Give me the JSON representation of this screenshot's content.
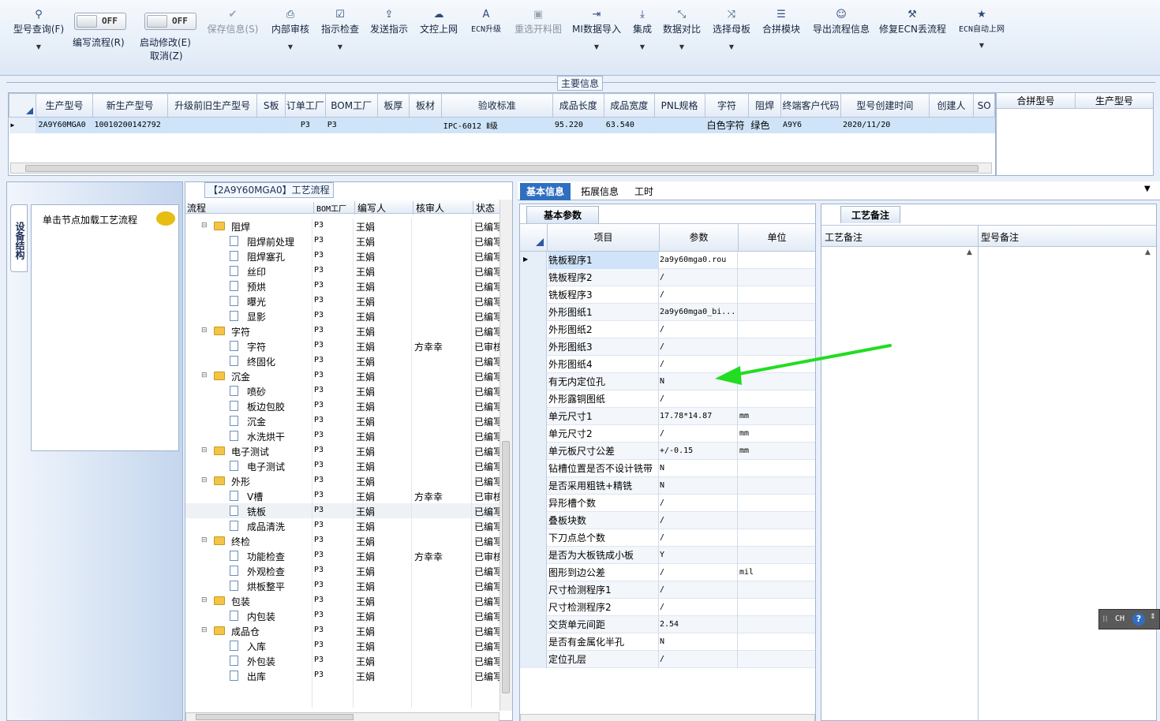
{
  "toolbar": {
    "query": "型号查询(F)",
    "edit_flow": "编写流程(R)",
    "toggle_off": "OFF",
    "start_modify": "启动修改(E)",
    "cancel": "取消(Z)",
    "save": "保存信息(S)",
    "internal_audit": "内部审核",
    "instr_check": "指示检查",
    "send_instr": "发送指示",
    "doc_upload": "文控上网",
    "ecn_upgrade": "ECN升级",
    "reselect_drawing": "重选开料图",
    "mi_import": "MI数据导入",
    "integrate": "集成",
    "data_compare": "数据对比",
    "select_mother": "选择母板",
    "merge_module": "合拼模块",
    "export_flow": "导出流程信息",
    "fix_ecn": "修复ECN丢流程",
    "ecn_auto": "ECN自动上网"
  },
  "main_info": {
    "title": "主要信息",
    "columns": [
      "生产型号",
      "新生产型号",
      "升级前旧生产型号",
      "S板",
      "订单工厂",
      "BOM工厂",
      "板厚",
      "板材",
      "验收标准",
      "成品长度",
      "成品宽度",
      "PNL规格",
      "字符",
      "阻焊",
      "终端客户代码",
      "型号创建时间",
      "创建人",
      "SO"
    ],
    "row": [
      "2A9Y60MGA0",
      "10010200142792",
      "",
      "",
      "P3",
      "P3",
      "",
      "",
      "IPC-6012 Ⅱ级",
      "95.220",
      "63.540",
      "",
      "白色字符",
      "绿色",
      "A9Y6",
      "2020/11/20",
      "",
      ""
    ],
    "merge_cols": [
      "合拼型号",
      "生产型号"
    ]
  },
  "left_panel": {
    "vertical_tab": "设备结构",
    "hint": "单击节点加载工艺流程"
  },
  "flow": {
    "title": "【2A9Y60MGA0】工艺流程",
    "columns": [
      "流程",
      "BOM工厂",
      "编写人",
      "核审人",
      "状态"
    ],
    "rows": [
      {
        "name": "阻焊",
        "folder": true,
        "f": "P3",
        "w": "王娟",
        "r": "",
        "s": "已编写"
      },
      {
        "name": "阻焊前处理",
        "folder": false,
        "f": "P3",
        "w": "王娟",
        "r": "",
        "s": "已编写"
      },
      {
        "name": "阻焊塞孔",
        "folder": false,
        "f": "P3",
        "w": "王娟",
        "r": "",
        "s": "已编写"
      },
      {
        "name": "丝印",
        "folder": false,
        "f": "P3",
        "w": "王娟",
        "r": "",
        "s": "已编写"
      },
      {
        "name": "预烘",
        "folder": false,
        "f": "P3",
        "w": "王娟",
        "r": "",
        "s": "已编写"
      },
      {
        "name": "曝光",
        "folder": false,
        "f": "P3",
        "w": "王娟",
        "r": "",
        "s": "已编写"
      },
      {
        "name": "显影",
        "folder": false,
        "f": "P3",
        "w": "王娟",
        "r": "",
        "s": "已编写"
      },
      {
        "name": "字符",
        "folder": true,
        "f": "P3",
        "w": "王娟",
        "r": "",
        "s": "已编写"
      },
      {
        "name": "字符",
        "folder": false,
        "f": "P3",
        "w": "王娟",
        "r": "方幸幸",
        "s": "已审核"
      },
      {
        "name": "终固化",
        "folder": false,
        "f": "P3",
        "w": "王娟",
        "r": "",
        "s": "已编写"
      },
      {
        "name": "沉金",
        "folder": true,
        "f": "P3",
        "w": "王娟",
        "r": "",
        "s": "已编写"
      },
      {
        "name": "喷砂",
        "folder": false,
        "f": "P3",
        "w": "王娟",
        "r": "",
        "s": "已编写"
      },
      {
        "name": "板边包胶",
        "folder": false,
        "f": "P3",
        "w": "王娟",
        "r": "",
        "s": "已编写"
      },
      {
        "name": "沉金",
        "folder": false,
        "f": "P3",
        "w": "王娟",
        "r": "",
        "s": "已编写"
      },
      {
        "name": "水洗烘干",
        "folder": false,
        "f": "P3",
        "w": "王娟",
        "r": "",
        "s": "已编写"
      },
      {
        "name": "电子测试",
        "folder": true,
        "f": "P3",
        "w": "王娟",
        "r": "",
        "s": "已编写"
      },
      {
        "name": "电子测试",
        "folder": false,
        "f": "P3",
        "w": "王娟",
        "r": "",
        "s": "已编写"
      },
      {
        "name": "外形",
        "folder": true,
        "f": "P3",
        "w": "王娟",
        "r": "",
        "s": "已编写"
      },
      {
        "name": "V槽",
        "folder": false,
        "f": "P3",
        "w": "王娟",
        "r": "方幸幸",
        "s": "已审核"
      },
      {
        "name": "铣板",
        "folder": false,
        "f": "P3",
        "w": "王娟",
        "r": "",
        "s": "已编写"
      },
      {
        "name": "成品清洗",
        "folder": false,
        "f": "P3",
        "w": "王娟",
        "r": "",
        "s": "已编写"
      },
      {
        "name": "终检",
        "folder": true,
        "f": "P3",
        "w": "王娟",
        "r": "",
        "s": "已编写"
      },
      {
        "name": "功能检查",
        "folder": false,
        "f": "P3",
        "w": "王娟",
        "r": "方幸幸",
        "s": "已审核"
      },
      {
        "name": "外观检查",
        "folder": false,
        "f": "P3",
        "w": "王娟",
        "r": "",
        "s": "已编写"
      },
      {
        "name": "烘板整平",
        "folder": false,
        "f": "P3",
        "w": "王娟",
        "r": "",
        "s": "已编写"
      },
      {
        "name": "包装",
        "folder": true,
        "f": "P3",
        "w": "王娟",
        "r": "",
        "s": "已编写"
      },
      {
        "name": "内包装",
        "folder": false,
        "f": "P3",
        "w": "王娟",
        "r": "",
        "s": "已编写"
      },
      {
        "name": "成品仓",
        "folder": true,
        "f": "P3",
        "w": "王娟",
        "r": "",
        "s": "已编写"
      },
      {
        "name": "入库",
        "folder": false,
        "f": "P3",
        "w": "王娟",
        "r": "",
        "s": "已编写"
      },
      {
        "name": "外包装",
        "folder": false,
        "f": "P3",
        "w": "王娟",
        "r": "",
        "s": "已编写"
      },
      {
        "name": "出库",
        "folder": false,
        "f": "P3",
        "w": "王娟",
        "r": "",
        "s": "已编写"
      }
    ]
  },
  "tabs": [
    "基本信息",
    "拓展信息",
    "工时"
  ],
  "params": {
    "subtab": "基本参数",
    "columns": [
      "项目",
      "参数",
      "单位"
    ],
    "rows": [
      [
        "铣板程序1",
        "2a9y60mga0.rou",
        ""
      ],
      [
        "铣板程序2",
        "/",
        ""
      ],
      [
        "铣板程序3",
        "/",
        ""
      ],
      [
        "外形图纸1",
        "2a9y60mga0_bi...",
        ""
      ],
      [
        "外形图纸2",
        "/",
        ""
      ],
      [
        "外形图纸3",
        "/",
        ""
      ],
      [
        "外形图纸4",
        "/",
        ""
      ],
      [
        "有无内定位孔",
        "N",
        ""
      ],
      [
        "外形露铜图纸",
        "/",
        ""
      ],
      [
        "单元尺寸1",
        "17.78*14.87",
        "mm"
      ],
      [
        "单元尺寸2",
        "/",
        "mm"
      ],
      [
        "单元板尺寸公差",
        "+/-0.15",
        "mm"
      ],
      [
        "钻槽位置是否不设计铣带",
        "N",
        ""
      ],
      [
        "是否采用粗铣+精铣",
        "N",
        ""
      ],
      [
        "异形槽个数",
        "/",
        ""
      ],
      [
        "叠板块数",
        "/",
        ""
      ],
      [
        "下刀点总个数",
        "/",
        ""
      ],
      [
        "是否为大板铣成小板",
        "Y",
        ""
      ],
      [
        "图形到边公差",
        "/",
        "mil"
      ],
      [
        "尺寸检测程序1",
        "/",
        ""
      ],
      [
        "尺寸检测程序2",
        "/",
        ""
      ],
      [
        "交货单元间距",
        "2.54",
        ""
      ],
      [
        "是否有金属化半孔",
        "N",
        ""
      ],
      [
        "定位孔层",
        "/",
        ""
      ]
    ]
  },
  "remarks": {
    "subtab": "工艺备注",
    "col1": "工艺备注",
    "col2": "型号备注"
  },
  "ime": {
    "lang": "CH",
    "help": "?"
  }
}
